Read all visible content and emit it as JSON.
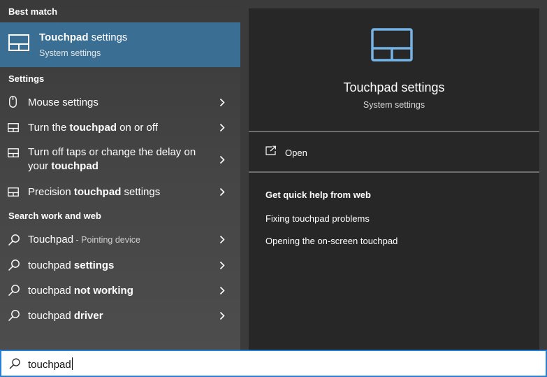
{
  "best_match": {
    "header": "Best match",
    "title": "Touchpad settings",
    "title_bold": "Touchpad",
    "title_rest": " settings",
    "subtitle": "System settings",
    "icon": "touchpad-icon"
  },
  "settings": {
    "header": "Settings",
    "items": [
      {
        "icon": "mouse-icon",
        "pre": "Mouse settings",
        "bold": "",
        "post": ""
      },
      {
        "icon": "touchpad-icon",
        "pre": "Turn the ",
        "bold": "touchpad",
        "post": " on or off"
      },
      {
        "icon": "touchpad-icon",
        "line1": "Turn off taps or change the delay on",
        "line2_pre": "your ",
        "line2_bold": "touchpad"
      },
      {
        "icon": "touchpad-icon",
        "pre": "Precision ",
        "bold": "touchpad",
        "post": " settings"
      }
    ]
  },
  "web": {
    "header": "Search work and web",
    "items": [
      {
        "icon": "search-icon",
        "pre": "Touchpad",
        "bold": "",
        "hint": " - Pointing device"
      },
      {
        "icon": "search-icon",
        "pre": "touchpad ",
        "bold": "settings"
      },
      {
        "icon": "search-icon",
        "pre": "touchpad ",
        "bold": "not working"
      },
      {
        "icon": "search-icon",
        "pre": "touchpad ",
        "bold": "driver"
      }
    ]
  },
  "preview": {
    "icon": "touchpad-icon",
    "title": "Touchpad settings",
    "subtitle": "System settings",
    "open_label": "Open",
    "help_header": "Get quick help from web",
    "help_links": [
      "Fixing touchpad problems",
      "Opening the on-screen touchpad"
    ]
  },
  "search": {
    "value": "touchpad"
  },
  "colors": {
    "selection": "#3a6e93",
    "accent": "#74b4e6",
    "search_border": "#2a7fd4"
  }
}
